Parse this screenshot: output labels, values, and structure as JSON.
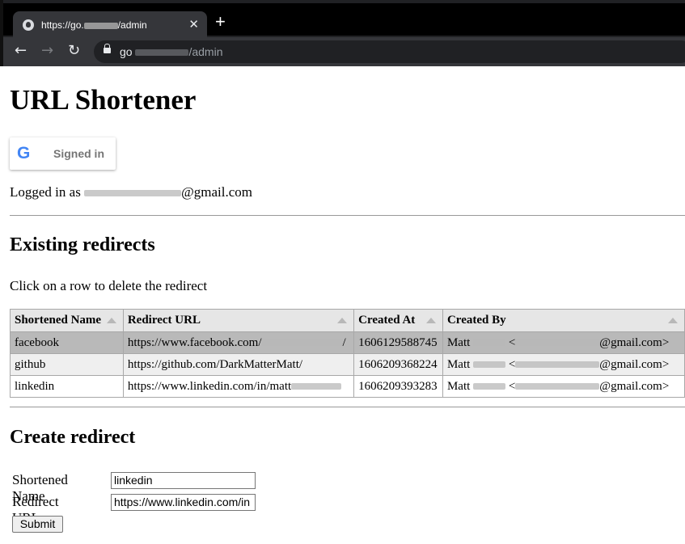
{
  "browser": {
    "tab_title_prefix": "https://go.",
    "tab_title_suffix": "/admin",
    "tab_close": "✕",
    "new_tab": "+",
    "url_prefix": "go",
    "url_suffix": "/admin"
  },
  "page": {
    "title": "URL Shortener",
    "signin_label": "Signed in",
    "logged_prefix": "Logged in as ",
    "logged_suffix": "@gmail.com",
    "existing_heading": "Existing redirects",
    "instructions": "Click on a row to delete the redirect",
    "table": {
      "headers": [
        "Shortened Name",
        "Redirect URL",
        "Created At",
        "Created By"
      ],
      "rows": [
        {
          "name": "facebook",
          "url": "https://www.facebook.com/",
          "url_tail": "/",
          "created_at": "1606129588745",
          "by_prefix": "Matt ",
          "by_mid": " <",
          "by_suffix": "@gmail.com>"
        },
        {
          "name": "github",
          "url": "https://github.com/DarkMatterMatt/",
          "url_tail": "",
          "created_at": "1606209368224",
          "by_prefix": "Matt ",
          "by_mid": " <",
          "by_suffix": "@gmail.com>"
        },
        {
          "name": "linkedin",
          "url": "https://www.linkedin.com/in/matt",
          "url_tail": "",
          "created_at": "1606209393283",
          "by_prefix": "Matt ",
          "by_mid": " <",
          "by_suffix": "@gmail.com>"
        }
      ]
    },
    "create_heading": "Create redirect",
    "form": {
      "name_label": "Shortened Name",
      "name_value": "linkedin",
      "url_label": "Redirect URL",
      "url_value": "https://www.linkedin.com/in",
      "submit_label": "Submit"
    }
  }
}
